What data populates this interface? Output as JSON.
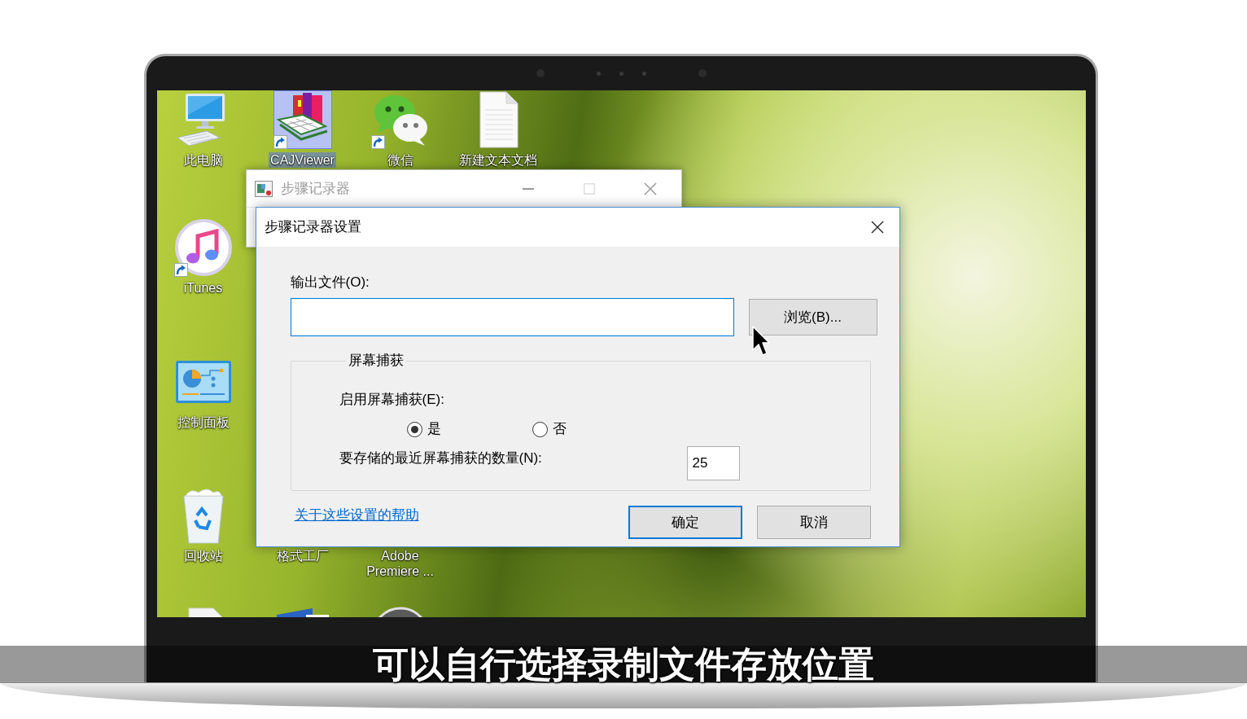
{
  "desktop": {
    "icons": [
      {
        "label": "此电脑",
        "kind": "computer",
        "shortcut": false,
        "selected": false
      },
      {
        "label": "iTunes",
        "kind": "music",
        "shortcut": true,
        "selected": false
      },
      {
        "label": "控制面板",
        "kind": "control_panel",
        "shortcut": false,
        "selected": false
      },
      {
        "label": "回收站",
        "kind": "recycle_bin",
        "shortcut": false,
        "selected": false
      },
      {
        "kind": "document",
        "selected": false
      },
      {
        "label": "CAJViewer",
        "kind": "reader",
        "shortcut": true,
        "selected": true
      },
      {
        "label": "格式工厂",
        "kind": "covered",
        "selected": false
      },
      {
        "kind": "window_app",
        "selected": false
      },
      {
        "label": "微信",
        "kind": "chat",
        "shortcut": true,
        "selected": false
      },
      {
        "label": "Adobe Premiere ...",
        "kind": "covered",
        "selected": false
      },
      {
        "kind": "disc",
        "selected": false
      },
      {
        "label": "新建文本文档",
        "kind": "text_file",
        "shortcut": false,
        "selected": false
      }
    ]
  },
  "recorder_window": {
    "title": "步骤记录器",
    "active": false,
    "can_maximize": false
  },
  "settings_dialog": {
    "title": "步骤记录器设置",
    "output_file": {
      "label": "输出文件(O):",
      "focused": true
    },
    "browse_button": "浏览(B)...",
    "screen_capture": {
      "title": "屏幕捕获",
      "enable_label": "启用屏幕捕获(E):",
      "options": [
        {
          "label": "是",
          "selected": true
        },
        {
          "label": "否",
          "selected": false
        }
      ],
      "count_label": "要存储的最近屏幕捕获的数量(N):",
      "count_value": "25"
    },
    "help_link": "关于这些设置的帮助",
    "buttons": [
      {
        "label": "确定",
        "default": true
      },
      {
        "label": "取消",
        "default": false
      }
    ]
  },
  "subtitle": "可以自行选择录制文件存放位置"
}
